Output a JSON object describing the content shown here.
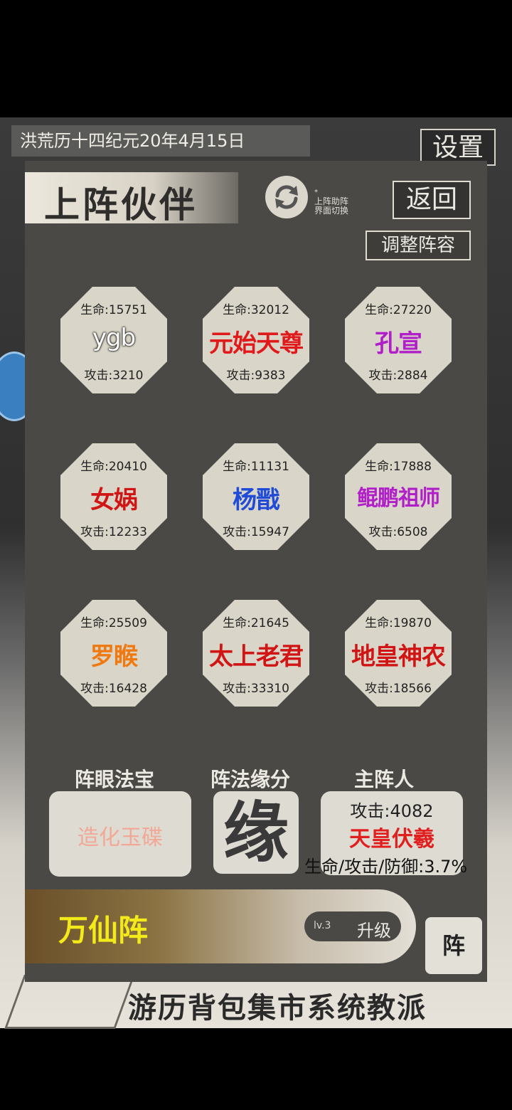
{
  "status": {
    "date": "洪荒历十四纪元20年4月15日",
    "settings_label": "设置"
  },
  "bottom_nav": {
    "label": "游历背包集市系统教派"
  },
  "panel": {
    "title": "上阵伙伴",
    "switch_note": [
      "上阵助阵",
      "界面切换"
    ],
    "back_label": "返回",
    "adjust_label": "调整阵容"
  },
  "partners": [
    {
      "hp": "生命:15751",
      "name": "ygb",
      "atk": "攻击:3210",
      "color": "#ffffff"
    },
    {
      "hp": "生命:32012",
      "name": "元始天尊",
      "atk": "攻击:9383",
      "color": "#e01a1a"
    },
    {
      "hp": "生命:27220",
      "name": "孔宣",
      "atk": "攻击:2884",
      "color": "#b11fc9"
    },
    {
      "hp": "生命:20410",
      "name": "女娲",
      "atk": "攻击:12233",
      "color": "#d11414"
    },
    {
      "hp": "生命:11131",
      "name": "杨戬",
      "atk": "攻击:15947",
      "color": "#1f4bd6"
    },
    {
      "hp": "生命:17888",
      "name": "鲲鹏祖师",
      "atk": "攻击:6508",
      "color": "#b11fc9"
    },
    {
      "hp": "生命:25509",
      "name": "罗睺",
      "atk": "攻击:16428",
      "color": "#f07a12"
    },
    {
      "hp": "生命:21645",
      "name": "太上老君",
      "atk": "攻击:33310",
      "color": "#d11414"
    },
    {
      "hp": "生命:19870",
      "name": "地皇神农",
      "atk": "攻击:18566",
      "color": "#d11414"
    }
  ],
  "formation": {
    "eye_label": "阵眼法宝",
    "eye_value": "造化玉碟",
    "fate_label": "阵法缘分",
    "fate_char": "缘",
    "leader_label": "主阵人",
    "leader_atk": "攻击:4082",
    "leader_name": "天皇伏羲",
    "leader_bonus": "生命/攻击/防御:3.7%",
    "name": "万仙阵",
    "level": "lv.3",
    "upgrade_label": "升级",
    "zhen_label": "阵"
  }
}
